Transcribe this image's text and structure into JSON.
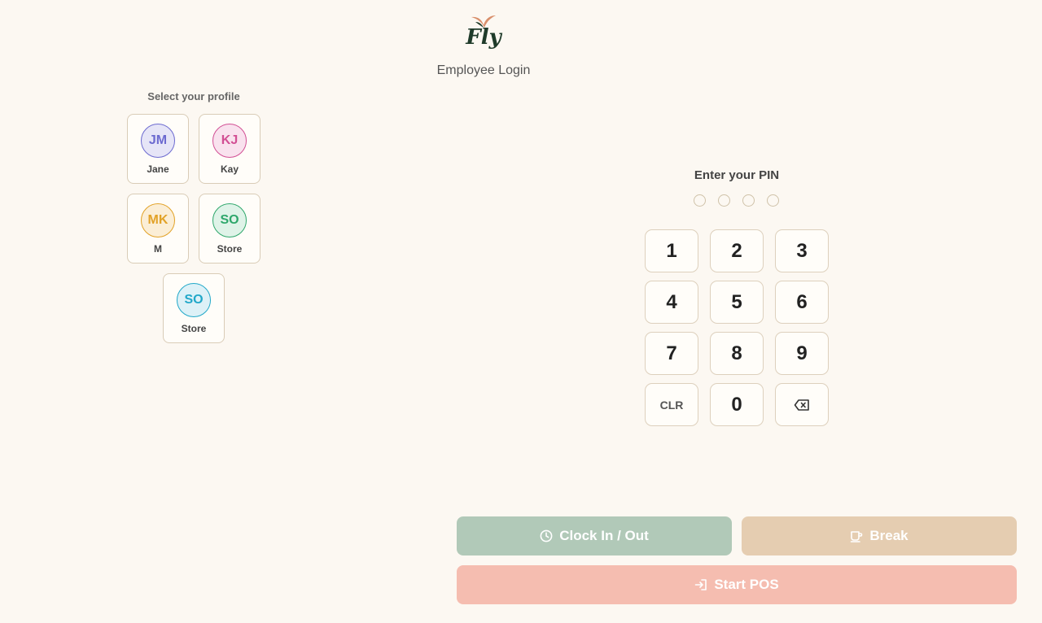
{
  "header": {
    "brand": "Fly",
    "title": "Employee Login"
  },
  "colors": {
    "background": "#fcf8f2",
    "card_border": "#d9ccb7",
    "clock_button": "#b1c9b8",
    "break_button": "#e5cdb1",
    "start_button": "#f5bdb0"
  },
  "profiles": {
    "label": "Select your profile",
    "items": [
      {
        "initials": "JM",
        "name": "Jane",
        "color": "#6c6ad0",
        "bg": "#e6e5f7"
      },
      {
        "initials": "KJ",
        "name": "Kay",
        "color": "#d24f94",
        "bg": "#f9e2ee"
      },
      {
        "initials": "MK",
        "name": "M",
        "color": "#e2a227",
        "bg": "#fbeed6"
      },
      {
        "initials": "SO",
        "name": "Store",
        "color": "#2ea76b",
        "bg": "#dff3e8"
      },
      {
        "initials": "SO",
        "name": "Store",
        "color": "#21a8c9",
        "bg": "#ddf1f7"
      }
    ]
  },
  "pin": {
    "label": "Enter your PIN",
    "length": 4,
    "entered": 0,
    "keys": [
      "1",
      "2",
      "3",
      "4",
      "5",
      "6",
      "7",
      "8",
      "9",
      "CLR",
      "0",
      "backspace-icon"
    ]
  },
  "actions": {
    "clock": {
      "label": "Clock In / Out",
      "icon": "clock-icon"
    },
    "break": {
      "label": "Break",
      "icon": "coffee-cup-icon"
    },
    "start": {
      "label": "Start POS",
      "icon": "login-icon"
    }
  }
}
